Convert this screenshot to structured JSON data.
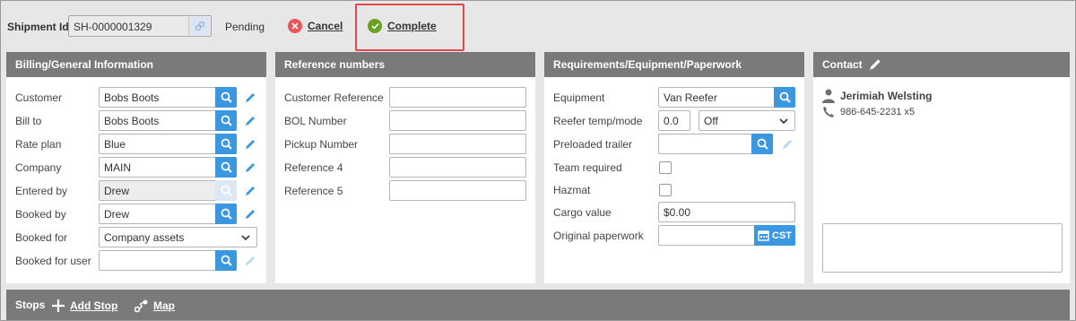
{
  "header": {
    "shipment_id_label": "Shipment Id",
    "shipment_id_value": "SH-0000001329",
    "status": "Pending",
    "cancel_label": "Cancel",
    "complete_label": "Complete"
  },
  "billing": {
    "title": "Billing/General Information",
    "fields": [
      {
        "label": "Customer",
        "value": "Bobs Boots"
      },
      {
        "label": "Bill to",
        "value": "Bobs Boots"
      },
      {
        "label": "Rate plan",
        "value": "Blue"
      },
      {
        "label": "Company",
        "value": "MAIN"
      },
      {
        "label": "Entered by",
        "value": "Drew"
      },
      {
        "label": "Booked by",
        "value": "Drew"
      },
      {
        "label": "Booked for",
        "value": "Company assets"
      },
      {
        "label": "Booked for user",
        "value": ""
      }
    ]
  },
  "reference": {
    "title": "Reference numbers",
    "fields": [
      {
        "label": "Customer Reference",
        "value": ""
      },
      {
        "label": "BOL Number",
        "value": ""
      },
      {
        "label": "Pickup Number",
        "value": ""
      },
      {
        "label": "Reference 4",
        "value": ""
      },
      {
        "label": "Reference 5",
        "value": ""
      }
    ]
  },
  "requirements": {
    "title": "Requirements/Equipment/Paperwork",
    "equipment_label": "Equipment",
    "equipment_value": "Van Reefer",
    "reefer_label": "Reefer temp/mode",
    "reefer_temp": "0.0",
    "reefer_mode": "Off",
    "preloaded_label": "Preloaded trailer",
    "preloaded_value": "",
    "team_label": "Team required",
    "hazmat_label": "Hazmat",
    "cargo_label": "Cargo value",
    "cargo_value": "$0.00",
    "paperwork_label": "Original paperwork",
    "paperwork_value": "",
    "tz_label": "CST"
  },
  "contact": {
    "title": "Contact",
    "name": "Jerimiah Welsting",
    "phone": "986-645-2231 x5",
    "notes": ""
  },
  "stops": {
    "title": "Stops",
    "add_stop_label": "Add Stop",
    "map_label": "Map"
  },
  "colors": {
    "accent_blue": "#3b97e0",
    "panel_header": "#7a7a7a",
    "cancel_red": "#e8565a",
    "complete_green": "#6aa121",
    "highlight_red": "#e0474c"
  }
}
